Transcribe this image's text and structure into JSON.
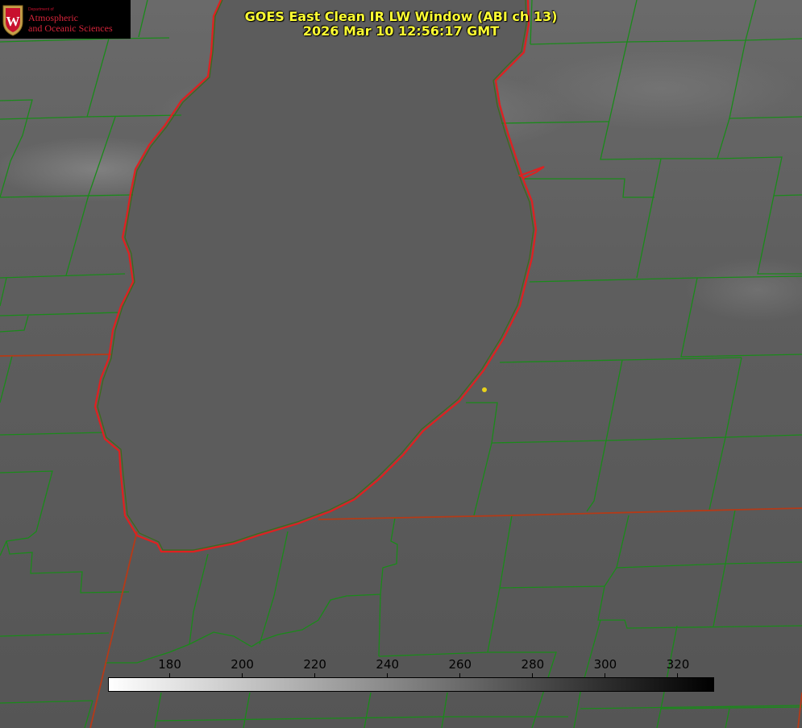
{
  "title_line1": "GOES East Clean IR LW Window (ABI ch 13)",
  "title_line2": "2026 Mar 10 12:56:17 GMT",
  "logo": {
    "department": "Department of",
    "line1": "Atmospheric",
    "line2": "and Oceanic Sciences"
  },
  "colorbar": {
    "min_value": 163,
    "max_value": 330,
    "ticks": [
      "180",
      "200",
      "220",
      "240",
      "260",
      "280",
      "300",
      "320"
    ],
    "tick_values": [
      180,
      200,
      220,
      240,
      260,
      280,
      300,
      320
    ],
    "gradient": [
      "#ffffff",
      "#000000"
    ]
  },
  "colors": {
    "county_lines": "#1a8a1a",
    "state_and_lake_lines": "#e02020",
    "marker": "#e8d21a",
    "title_text": "#ffff33"
  }
}
